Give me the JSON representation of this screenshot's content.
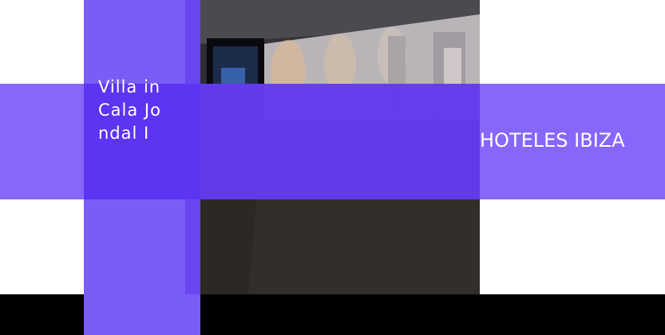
{
  "header": {
    "title": "Villa in Cala Jondal I",
    "brand": "HOTELES IBIZA"
  },
  "photo": {
    "subject": "hotel-corridor-image"
  },
  "colors": {
    "accent_purple": "#7a5cf6",
    "overlap_purple": "#5c34f2",
    "bottom_bar": "#000000"
  }
}
